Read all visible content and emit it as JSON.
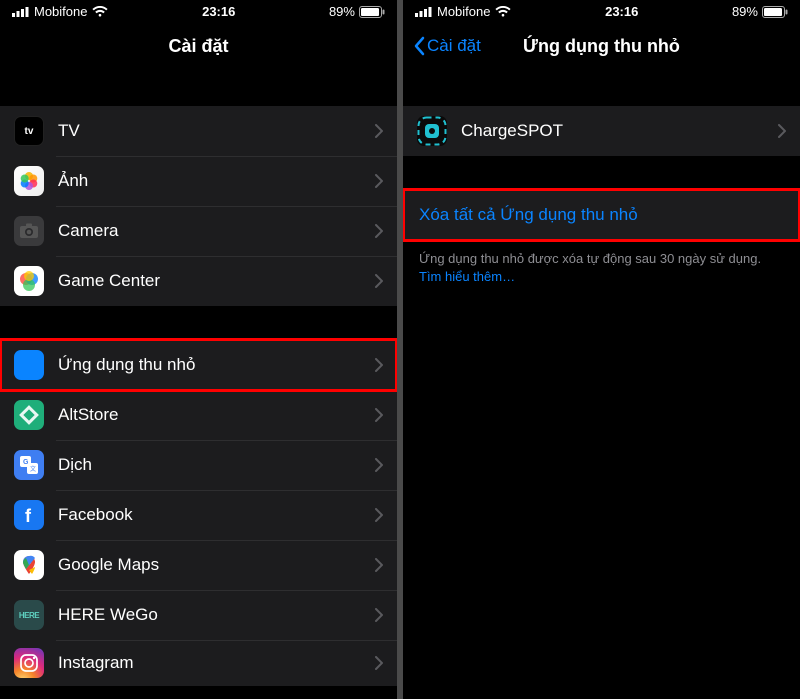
{
  "status": {
    "carrier": "Mobifone",
    "time": "23:16",
    "battery": "89%"
  },
  "left": {
    "title": "Cài đặt",
    "rows": [
      {
        "label": "TV"
      },
      {
        "label": "Ảnh"
      },
      {
        "label": "Camera"
      },
      {
        "label": "Game Center"
      },
      {
        "label": "Ứng dụng thu nhỏ"
      },
      {
        "label": "AltStore"
      },
      {
        "label": "Dịch"
      },
      {
        "label": "Facebook"
      },
      {
        "label": "Google Maps"
      },
      {
        "label": "HERE WeGo"
      },
      {
        "label": "Instagram"
      }
    ]
  },
  "right": {
    "back": "Cài đặt",
    "title": "Ứng dụng thu nhỏ",
    "app": {
      "label": "ChargeSPOT"
    },
    "delete_all": "Xóa tất cả Ứng dụng thu nhỏ",
    "footer_text": "Ứng dụng thu nhỏ được xóa tự động sau 30 ngày sử dụng. ",
    "footer_link": "Tìm hiểu thêm…"
  }
}
